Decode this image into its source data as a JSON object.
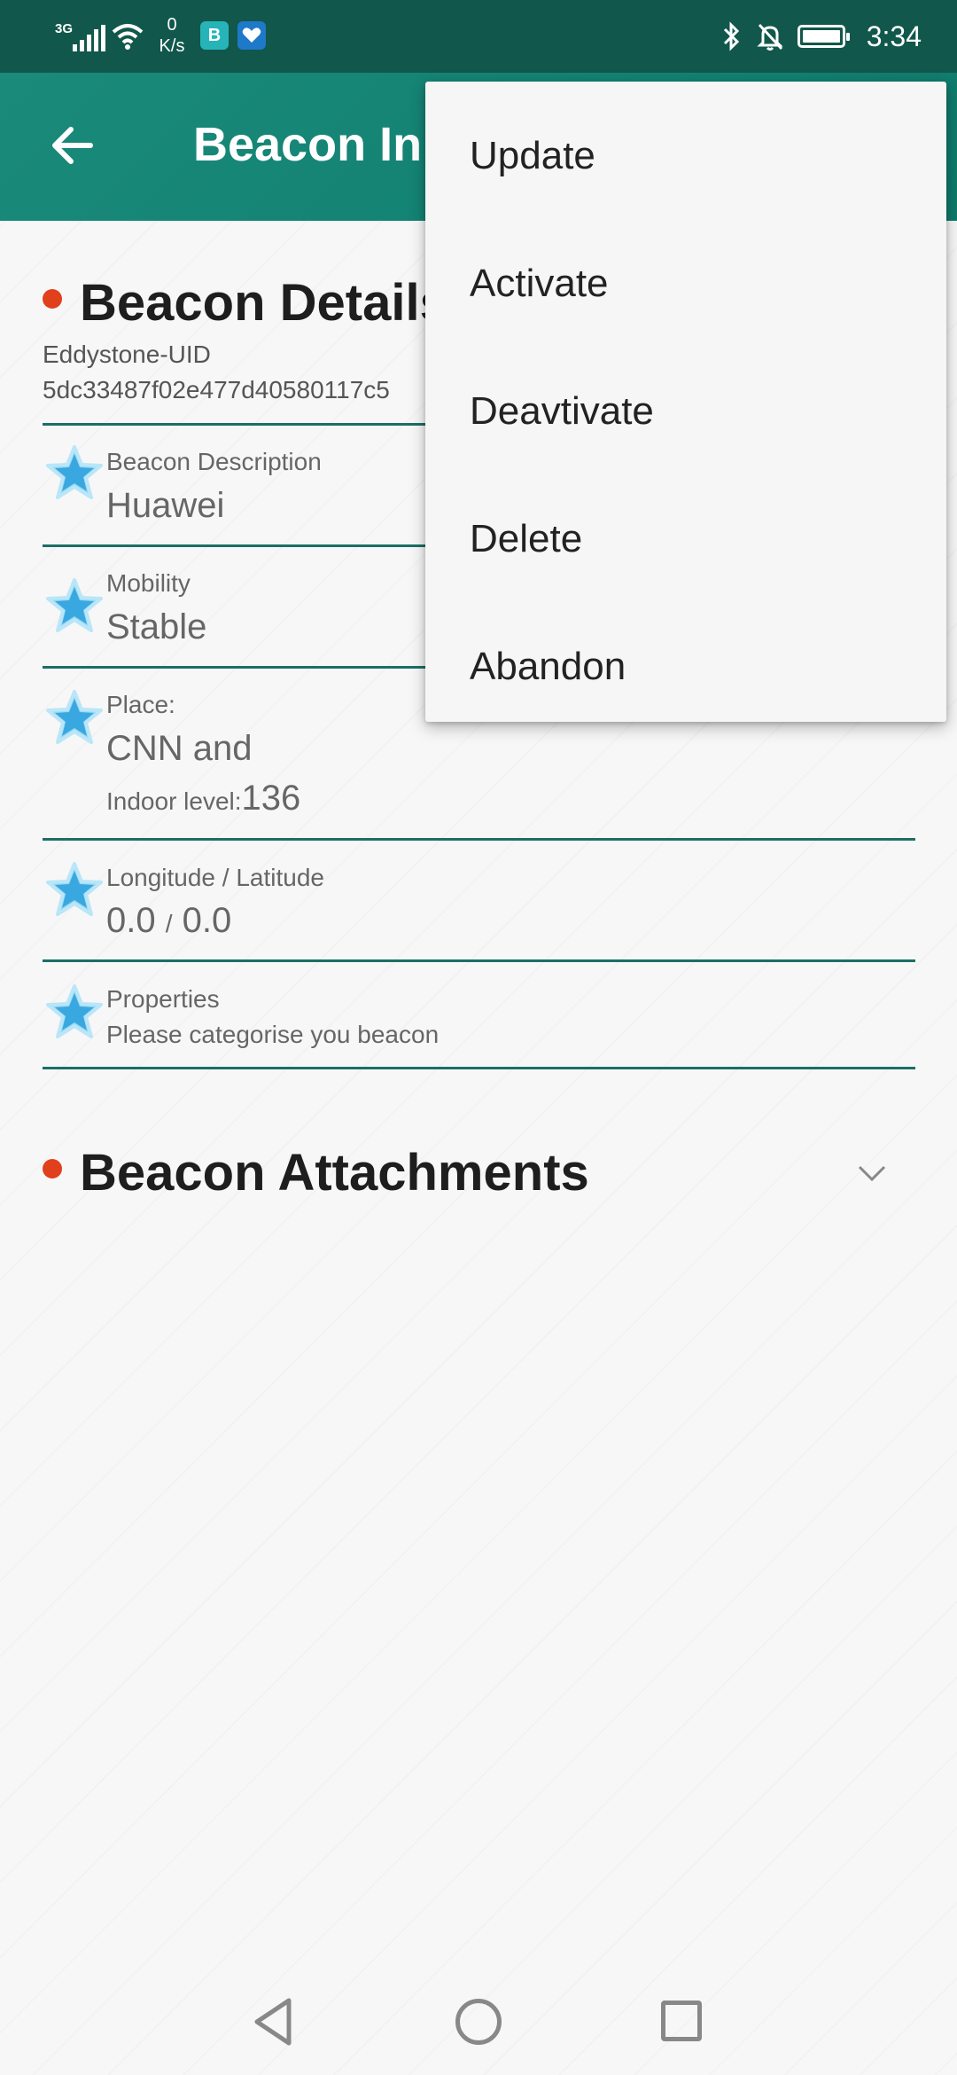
{
  "status_bar": {
    "network_type": "3G",
    "speed_value": "0",
    "speed_unit": "K/s",
    "app_badge_1": "B",
    "time": "3:34",
    "icons": [
      "signal-icon",
      "wifi-icon",
      "bluetooth-icon",
      "bell-off-icon",
      "battery-icon"
    ]
  },
  "app_bar": {
    "title": "Beacon In"
  },
  "details": {
    "section_title": "Beacon Details",
    "uid_type": "Eddystone-UID",
    "uid_value": "5dc33487f02e477d40580117c5",
    "fields": [
      {
        "label": "Beacon Description",
        "value": "Huawei"
      },
      {
        "label": "Mobility",
        "value": "Stable"
      },
      {
        "label": "Place:",
        "value": "CNN and",
        "extra_label": "Indoor level:",
        "extra_value": "136"
      },
      {
        "label": "Longitude / Latitude",
        "value_a": "0.0",
        "sep": "/",
        "value_b": "0.0"
      },
      {
        "label": "Properties",
        "value": "Please categorise you beacon"
      }
    ]
  },
  "attachments": {
    "section_title": "Beacon Attachments"
  },
  "menu": {
    "items": [
      "Update",
      "Activate",
      "Deavtivate",
      "Delete",
      "Abandon"
    ]
  },
  "colors": {
    "status_bar": "#11574c",
    "app_bar": "#138273",
    "accent_dot": "#e0401c",
    "divider": "#1b6f64",
    "star": "#3aa8e0"
  }
}
